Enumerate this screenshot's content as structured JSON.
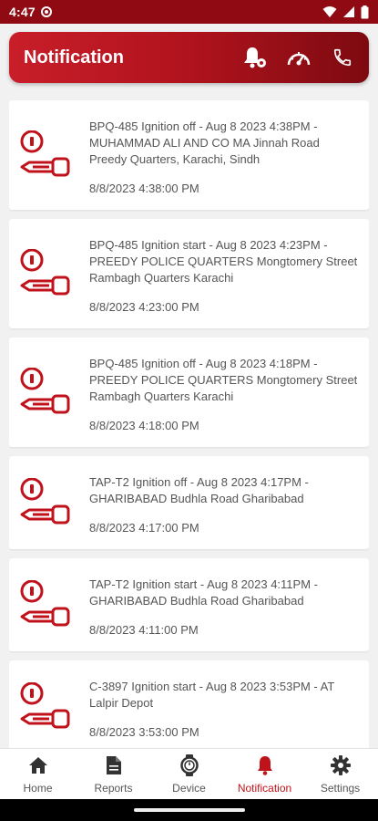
{
  "status_bar": {
    "time": "4:47"
  },
  "header": {
    "title": "Notification"
  },
  "notifications": [
    {
      "message": "BPQ-485 Ignition off - Aug  8 2023  4:38PM - MUHAMMAD ALI AND CO MA Jinnah Road Preedy Quarters, Karachi, Sindh",
      "timestamp": "8/8/2023 4:38:00 PM"
    },
    {
      "message": "BPQ-485 Ignition start - Aug  8 2023  4:23PM - PREEDY POLICE QUARTERS Mongtomery Street Rambagh Quarters Karachi",
      "timestamp": "8/8/2023 4:23:00 PM"
    },
    {
      "message": "BPQ-485 Ignition off - Aug  8 2023  4:18PM - PREEDY POLICE QUARTERS Mongtomery Street Rambagh Quarters Karachi",
      "timestamp": "8/8/2023 4:18:00 PM"
    },
    {
      "message": "TAP-T2 Ignition off - Aug  8 2023  4:17PM - GHARIBABAD Budhla Road Gharibabad",
      "timestamp": "8/8/2023 4:17:00 PM"
    },
    {
      "message": "TAP-T2 Ignition start - Aug  8 2023  4:11PM - GHARIBABAD Budhla Road Gharibabad",
      "timestamp": "8/8/2023 4:11:00 PM"
    },
    {
      "message": "C-3897 Ignition start - Aug  8 2023  3:53PM - AT Lalpir Depot",
      "timestamp": "8/8/2023 3:53:00 PM"
    }
  ],
  "bottom_nav": {
    "items": [
      {
        "label": "Home",
        "icon": "home-icon"
      },
      {
        "label": "Reports",
        "icon": "document-icon"
      },
      {
        "label": "Device",
        "icon": "watch-icon"
      },
      {
        "label": "Notification",
        "icon": "bell-icon",
        "active": true
      },
      {
        "label": "Settings",
        "icon": "gear-icon"
      }
    ]
  },
  "colors": {
    "accent": "#c0121b",
    "header_dark": "#7d0a10",
    "status_bar": "#8f0a12",
    "key_icon": "#c0121b"
  }
}
